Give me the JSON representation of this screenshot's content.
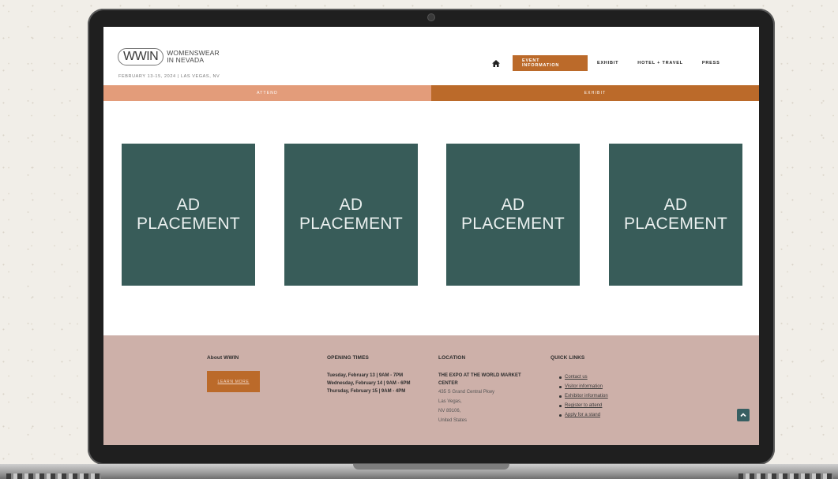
{
  "header": {
    "logo_mark": "WWIN",
    "logo_line1": "WOMENSWEAR",
    "logo_line2": "IN NEVADA",
    "event_dates": "FEBRUARY 13-15, 2024 | LAS VEGAS, NV"
  },
  "nav": {
    "home_icon": "home-icon",
    "items": [
      {
        "label": "EVENT INFORMATION",
        "active": true
      },
      {
        "label": "EXHIBIT",
        "active": false
      },
      {
        "label": "HOTEL + TRAVEL",
        "active": false
      },
      {
        "label": "PRESS",
        "active": false
      }
    ]
  },
  "subnav": {
    "attend": "ATTEND",
    "exhibit": "EXHIBIT"
  },
  "ads": [
    {
      "line1": "AD",
      "line2": "PLACEMENT"
    },
    {
      "line1": "AD",
      "line2": "PLACEMENT"
    },
    {
      "line1": "AD",
      "line2": "PLACEMENT"
    },
    {
      "line1": "AD",
      "line2": "PLACEMENT"
    }
  ],
  "footer": {
    "about": {
      "heading": "About WWIN",
      "button": "LEARN MORE"
    },
    "opening": {
      "heading": "OPENING TIMES",
      "lines": [
        "Tuesday, February 13 | 9AM - 7PM",
        "Wednesday, February 14 | 9AM - 6PM",
        "Thursday, February 15 | 9AM - 4PM"
      ]
    },
    "location": {
      "heading": "LOCATION",
      "name": "THE EXPO AT THE WORLD MARKET CENTER",
      "lines": [
        "435 S Grand Central Pkwy",
        "Las Vegas,",
        "NV 89106,",
        "United States"
      ]
    },
    "quick_links": {
      "heading": "QUICK LINKS",
      "items": [
        "Contact us",
        "Visitor information",
        "Exhibitor information",
        "Register to attend",
        "Apply for a stand"
      ]
    }
  },
  "colors": {
    "accent": "#bb6a2a",
    "attend_tab": "#e39c7a",
    "ad_green": "#385c59",
    "footer_bg": "#cdb0a9"
  },
  "icons": {
    "scroll_top": "chevron-up-icon"
  }
}
